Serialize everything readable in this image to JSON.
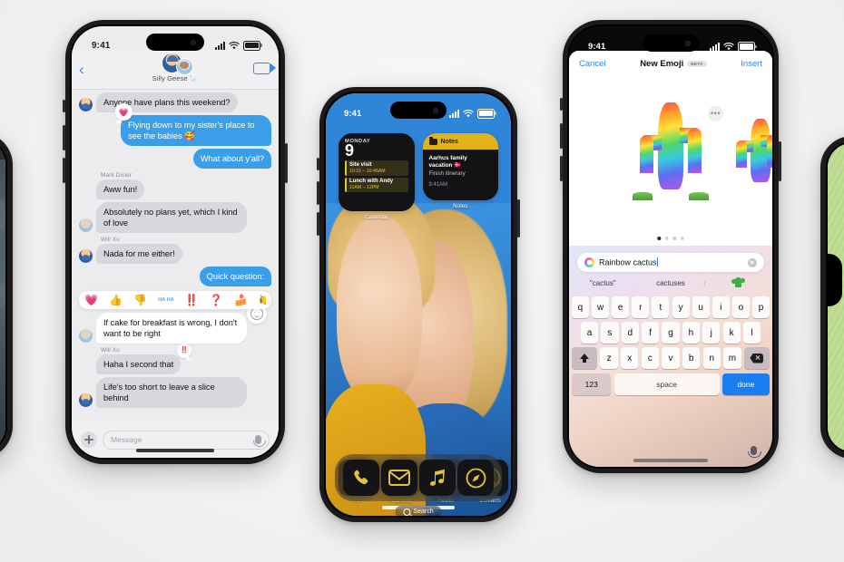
{
  "scene": {
    "background_color": "#f4f4f4",
    "device_count": 5
  },
  "messages_phone": {
    "status": {
      "time": "9:41",
      "signal_icon": "cellular-bars-icon",
      "wifi_icon": "wifi-icon",
      "battery_icon": "battery-icon"
    },
    "nav": {
      "back_icon": "chevron-left-icon",
      "facetime_icon": "video-camera-icon",
      "group_title": "Silly Geese 🦢",
      "avatar_icon": "group-avatar-icon"
    },
    "thread": [
      {
        "id": "m1",
        "side": "in",
        "sender": "",
        "text": "Anyone have plans this weekend?",
        "avatar": "blue",
        "tapback": "",
        "style": "gray"
      },
      {
        "id": "m2",
        "side": "out",
        "sender": "",
        "text": "Flying down to my sister's place to see the babies 🥰",
        "avatar": "",
        "tapback": "💗",
        "style": "blue"
      },
      {
        "id": "m3",
        "side": "out",
        "sender": "",
        "text": "What about y'all?",
        "avatar": "",
        "tapback": "",
        "style": "blue"
      },
      {
        "id": "m4",
        "side": "in",
        "sender": "Mark Disler",
        "text": "Aww fun!",
        "avatar": "",
        "tapback": "",
        "style": "gray"
      },
      {
        "id": "m5",
        "side": "in",
        "sender": "",
        "text": "Absolutely no plans yet, which I kind of love",
        "avatar": "brown",
        "tapback": "",
        "style": "gray"
      },
      {
        "id": "m6",
        "side": "in",
        "sender": "Will Xu",
        "text": "Nada for me either!",
        "avatar": "blue",
        "tapback": "",
        "style": "gray"
      },
      {
        "id": "m7",
        "side": "out",
        "sender": "",
        "text": "Quick question:",
        "avatar": "",
        "tapback": "",
        "style": "blue"
      },
      {
        "id": "m8",
        "side": "in",
        "sender": "",
        "text": "If cake for breakfast is wrong, I don't want to be right",
        "avatar": "brown",
        "tapback": "",
        "style": "white"
      },
      {
        "id": "m9",
        "side": "in",
        "sender": "Will Xu",
        "text": "Haha I second that",
        "avatar": "",
        "tapback": "‼️",
        "style": "gray"
      },
      {
        "id": "m10",
        "side": "in",
        "sender": "",
        "text": "Life's too short to leave a slice behind",
        "avatar": "blue",
        "tapback": "",
        "style": "gray"
      }
    ],
    "tapback_bar": {
      "options": [
        "💗",
        "👍",
        "👎",
        "HA HA",
        "‼️",
        "❓",
        "🍰",
        "🍋"
      ],
      "name": "tapback-picker"
    },
    "composer": {
      "add_icon": "plus-icon",
      "placeholder": "Message",
      "mic_icon": "microphone-icon"
    }
  },
  "home_phone": {
    "status": {
      "time": "9:41",
      "signal_icon": "cellular-bars-icon",
      "wifi_icon": "wifi-icon",
      "battery_icon": "battery-icon"
    },
    "widgets": [
      {
        "name": "calendar-widget",
        "label": "Calendar",
        "weekday": "MONDAY",
        "day": "9",
        "events": [
          {
            "title": "Site visit",
            "time": "10:15 – 10:45AM"
          },
          {
            "title": "Lunch with Andy",
            "time": "11AM – 12PM"
          }
        ]
      },
      {
        "name": "notes-widget",
        "label": "Notes",
        "header": "Notes",
        "title": "Aarhus family vacation 🇩🇰",
        "subtitle": "Finish itinerary",
        "time": "9:41AM"
      }
    ],
    "apps": [
      {
        "name": "tv-app",
        "label": "TV",
        "icon": "apple-tv-icon"
      },
      {
        "name": "camera-app",
        "label": "Camera",
        "icon": "camera-icon"
      },
      {
        "name": "health-app",
        "label": "Health",
        "icon": "heart-icon"
      },
      {
        "name": "contacts-app",
        "label": "Contacts",
        "icon": "contact-person-icon"
      }
    ],
    "search_pill": {
      "label": "Search",
      "icon": "magnifier-icon"
    },
    "dock": [
      {
        "name": "phone-app",
        "icon": "phone-handset-icon"
      },
      {
        "name": "mail-app",
        "icon": "envelope-icon"
      },
      {
        "name": "music-app",
        "icon": "music-note-icon"
      },
      {
        "name": "safari-app",
        "icon": "compass-icon"
      }
    ],
    "wallpaper": "photo-of-child-and-woman-against-blue-sky"
  },
  "emoji_phone": {
    "status": {
      "time": "9:41",
      "signal_icon": "cellular-bars-icon",
      "wifi_icon": "wifi-icon",
      "battery_icon": "battery-icon"
    },
    "sheet": {
      "cancel_label": "Cancel",
      "title": "New Emoji",
      "badge": "BETA",
      "insert_label": "Insert",
      "more_icon": "ellipsis-icon",
      "page_dots": 4,
      "active_dot": 1,
      "results": [
        {
          "name": "genmoji-result-primary",
          "description": "rainbow cactus"
        },
        {
          "name": "genmoji-result-secondary",
          "description": "rainbow cactus variant"
        }
      ]
    },
    "search": {
      "icon": "ai-sparkle-icon",
      "value": "Rainbow cactus",
      "clear_icon": "clear-circle-icon"
    },
    "suggestions": [
      "\"cactus\"",
      "cactuses",
      "🌵"
    ],
    "keyboard": {
      "row1": [
        "q",
        "w",
        "e",
        "r",
        "t",
        "y",
        "u",
        "i",
        "o",
        "p"
      ],
      "row2": [
        "a",
        "s",
        "d",
        "f",
        "g",
        "h",
        "j",
        "k",
        "l"
      ],
      "row3_shift_icon": "shift-icon",
      "row3": [
        "z",
        "x",
        "c",
        "v",
        "b",
        "n",
        "m"
      ],
      "row3_delete_icon": "delete-icon",
      "numbers_label": "123",
      "space_label": "space",
      "done_label": "done",
      "mic_icon": "microphone-icon"
    }
  },
  "edge_phones": {
    "left": {
      "name": "left-partial-phone",
      "screen": "dark-teal-video-call-screen"
    },
    "right": {
      "name": "right-partial-phone",
      "screen": "light-green-wallpaper"
    }
  }
}
